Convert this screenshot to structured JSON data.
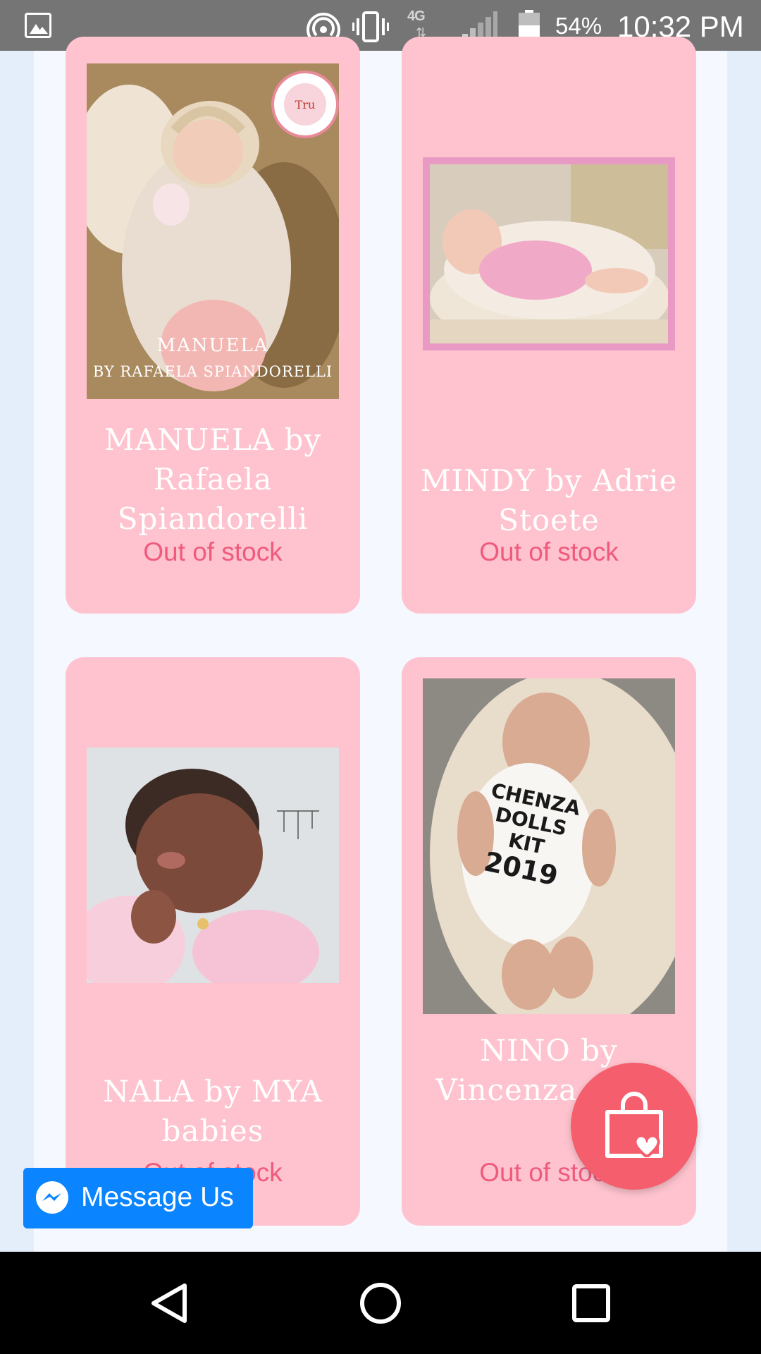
{
  "status_bar": {
    "battery_percent": "54%",
    "time": "10:32 PM",
    "network_label": "4G",
    "icons": [
      "image-icon",
      "hotspot-icon",
      "vibrate-icon",
      "network-4g-icon",
      "signal-icon",
      "battery-icon"
    ]
  },
  "products": [
    {
      "title": "MANUELA by Rafaela Spiandorelli",
      "stock": "Out of stock",
      "image_caption_line1": "MANUELA",
      "image_caption_line2": "BY RAFAELA SPIANDORELLI"
    },
    {
      "title": "MINDY by Adrie Stoete",
      "stock": "Out of stock"
    },
    {
      "title": "NALA by MYA babies",
      "stock": "Out of stock"
    },
    {
      "title": "NINO by Vincenza Care",
      "stock": "Out of stock",
      "image_shirt_text": [
        "CHENZA",
        "DOLLS",
        "KIT",
        "2019"
      ]
    }
  ],
  "messenger": {
    "label": "Message Us",
    "icon": "messenger-icon",
    "color": "#0a84ff"
  },
  "wishlist": {
    "icon": "shopping-bag-heart-icon",
    "color": "#f45e6d"
  },
  "nav_bar": {
    "icons": [
      "back-icon",
      "home-icon",
      "recents-icon"
    ]
  },
  "colors": {
    "card_background": "#fec3ce",
    "stock_text": "#ef5a7d",
    "page_background": "#e4eefb"
  }
}
